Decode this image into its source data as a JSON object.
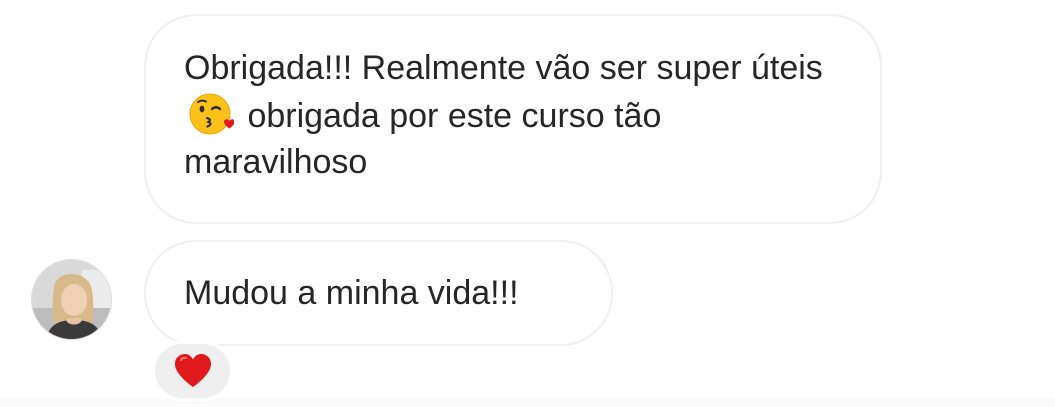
{
  "messages": [
    {
      "text_before_emoji": "Obrigada!!! Realmente vão ser super úteis",
      "emoji": "kissing-face-with-heart-emoji",
      "text_after_emoji": "obrigada por este curso tão maravilhoso"
    },
    {
      "text": "Mudou a minha vida!!!"
    }
  ],
  "sender_avatar": "user-avatar-photo",
  "reaction": "red-heart-icon",
  "colors": {
    "bubble_border": "#efefef",
    "text": "#262626",
    "reaction_bg": "#efefef",
    "heart": "#e0191d"
  }
}
